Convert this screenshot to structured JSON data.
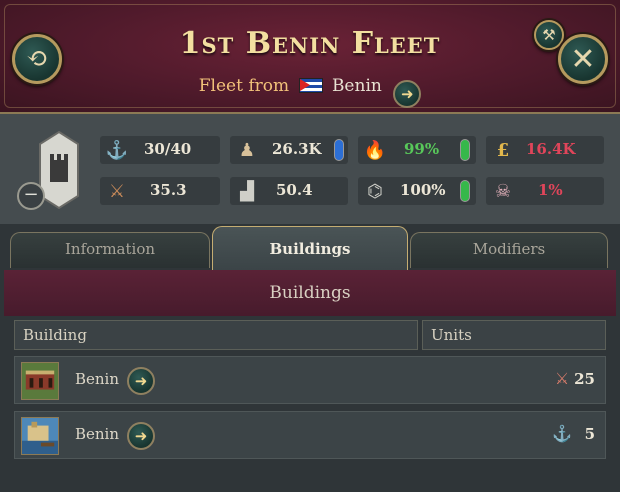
{
  "header": {
    "title": "1st Benin Fleet",
    "subtitle_prefix": "Fleet from",
    "subtitle_country": "Benin"
  },
  "stats": {
    "ships": "30/40",
    "manpower": "26.3K",
    "morale": "99%",
    "upkeep": "16.4K",
    "offense": "35.3",
    "defense": "50.4",
    "organization": "100%",
    "attrition": "1%"
  },
  "tabs": [
    {
      "label": "Information"
    },
    {
      "label": "Buildings"
    },
    {
      "label": "Modifiers"
    }
  ],
  "section": {
    "title": "Buildings"
  },
  "columns": {
    "building": "Building",
    "units": "Units"
  },
  "rows": [
    {
      "name": "Benin",
      "units": "25",
      "unit_icon": "musket-icon"
    },
    {
      "name": "Benin",
      "units": "5",
      "unit_icon": "anchor-icon"
    }
  ],
  "colors": {
    "header_bg": "#4f1a2b",
    "accent_gold": "#f3dfa0",
    "positive": "#58c85a",
    "negative": "#e0455a"
  }
}
